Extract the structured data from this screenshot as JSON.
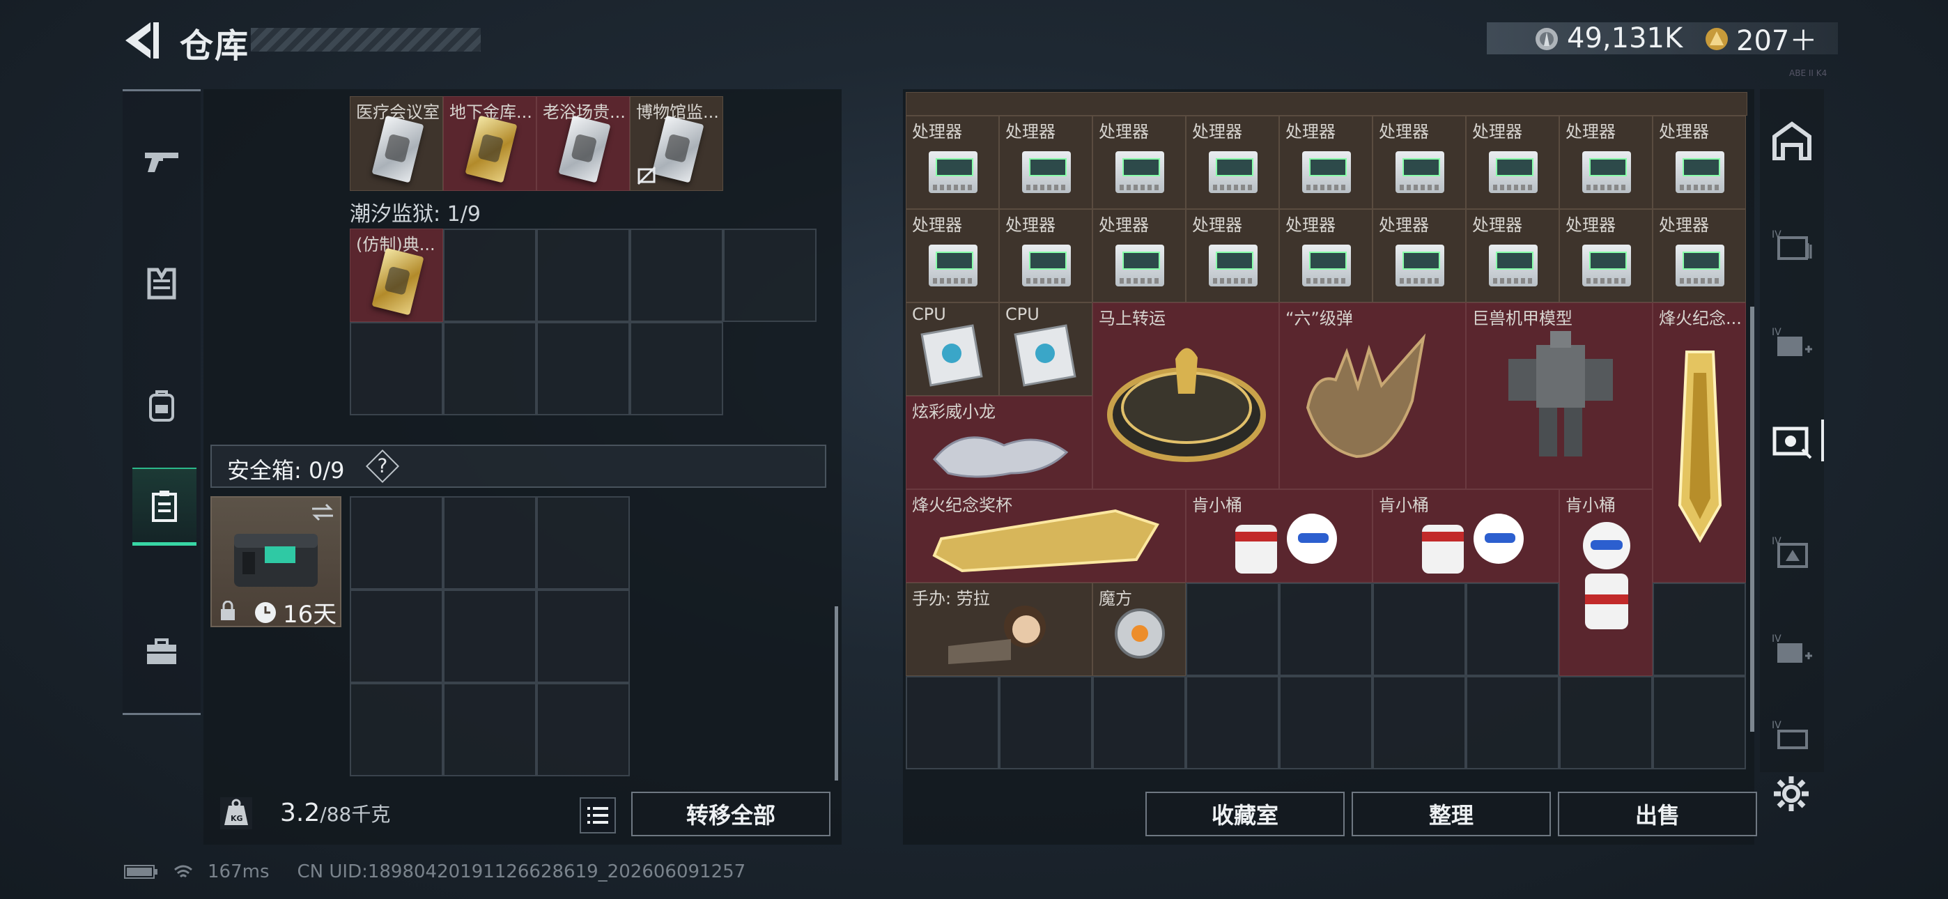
{
  "header": {
    "title": "仓库",
    "silver_value": "49,131K",
    "gold_value": "207＋",
    "version_tag": "ABE II K4"
  },
  "left_nav": {
    "items": [
      "firearm-icon",
      "armor-vest-icon",
      "backpack-icon",
      "safe-case-icon",
      "toolbox-icon"
    ]
  },
  "left_panel": {
    "top_cards": [
      {
        "label": "医疗会议室",
        "card": "silver"
      },
      {
        "label": "地下金库...",
        "card": "gold"
      },
      {
        "label": "老浴场贵...",
        "card": "silver"
      },
      {
        "label": "博物馆监...",
        "card": "silver"
      }
    ],
    "section_title": "潮汐监狱: 1/9",
    "prison_card": {
      "label": "(仿制)典...",
      "card": "gold"
    },
    "safe_box": {
      "label": "安全箱: 0/9",
      "help": "?",
      "days": "16天"
    },
    "weight": {
      "value": "3.2",
      "capacity": "/88千克"
    },
    "transfer_label": "转移全部"
  },
  "right_panel": {
    "processor_label": "处理器",
    "cpu_label": "CPU",
    "items": {
      "horse": "马上转运",
      "six_bullet": "“六”级弹",
      "mech": "巨兽机甲模型",
      "beacon_tall": "烽火纪念...",
      "dragon": "炫彩威小龙",
      "trophy": "烽火纪念奖杯",
      "bucket1": "肯小桶",
      "bucket2": "肯小桶",
      "bucket3": "肯小桶",
      "figure": "手办: 劳拉",
      "cube": "魔方"
    },
    "buttons": {
      "collection": "收藏室",
      "sort": "整理",
      "sell": "出售"
    }
  },
  "right_nav": {
    "items": [
      "home-base-icon",
      "warehouse-tab-iv-1",
      "warehouse-tab-iv-add",
      "warehouse-tab-active",
      "warehouse-tab-iv-3",
      "warehouse-tab-iv-add-2",
      "warehouse-tab-iv-4"
    ]
  },
  "status": {
    "ping": "167ms",
    "uid": "CN UID:18980420191126628619_202606091257"
  }
}
